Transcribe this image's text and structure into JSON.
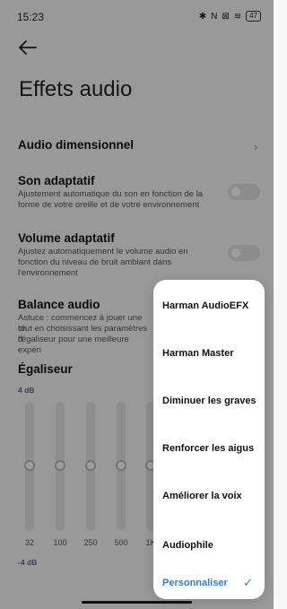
{
  "status_bar": {
    "time": "15:23",
    "battery": "47",
    "icons": [
      "bluetooth-icon",
      "nfc-icon",
      "sim-icon",
      "wifi-icon"
    ]
  },
  "page": {
    "title": "Effets audio"
  },
  "settings": {
    "audio_dim": {
      "title": "Audio dimensionnel"
    },
    "son_adaptatif": {
      "title": "Son adaptatif",
      "desc": "Ajustement automatique du son en fonction de la forme de votre oreille et de votre environnement",
      "enabled": false
    },
    "volume_adaptatif": {
      "title": "Volume adaptatif",
      "desc": "Ajustez automatiquement le volume audio en fonction du niveau de bruit ambiant dans l'environnement",
      "enabled": false
    },
    "balance": {
      "title": "Balance audio",
      "desc_line1": "Astuce : commencez à jouer une ch",
      "desc_line2": "tout en choisissant les paramètres d",
      "desc_line3": "l'égaliseur pour une meilleure expéri"
    }
  },
  "equalizer": {
    "title": "Égaliseur",
    "max_label": "4 dB",
    "min_label": "-4 dB",
    "bands": [
      {
        "freq": "32",
        "level": 0
      },
      {
        "freq": "100",
        "level": 0
      },
      {
        "freq": "250",
        "level": 0
      },
      {
        "freq": "500",
        "level": 0
      },
      {
        "freq": "1K",
        "level": 0
      }
    ]
  },
  "menu": {
    "items": [
      {
        "label": "Harman AudioEFX"
      },
      {
        "label": "Harman Master"
      },
      {
        "label": "Diminuer les graves"
      },
      {
        "label": "Renforcer les aigus"
      },
      {
        "label": "Améliorer la voix"
      },
      {
        "label": "Audiophile"
      },
      {
        "label": "Personnaliser"
      }
    ],
    "selected": "Personnaliser",
    "accent_color": "#2c7fd6"
  }
}
